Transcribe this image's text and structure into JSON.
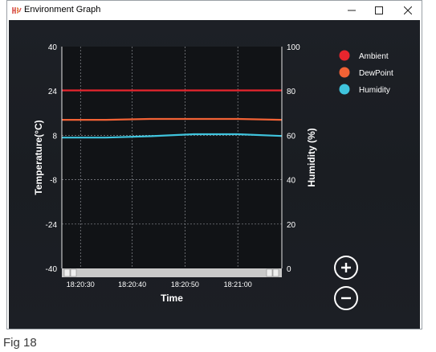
{
  "window": {
    "title": "Environment Graph",
    "controls": [
      "minimize",
      "maximize",
      "close"
    ]
  },
  "chart_data": {
    "type": "line",
    "xlabel": "Time",
    "ylabel_left": "Temperature(°C)",
    "ylabel_right": "Humidity (%)",
    "x_ticks": [
      "18:20:30",
      "18:20:40",
      "18:20:50",
      "18:21:00"
    ],
    "left_axis": {
      "ylim": [
        -40,
        40
      ],
      "ticks": [
        "40",
        "24",
        "8",
        "-8",
        "-24",
        "-40"
      ]
    },
    "right_axis": {
      "ylim": [
        0,
        100
      ],
      "ticks": [
        "100",
        "80",
        "60",
        "40",
        "20",
        "0"
      ]
    },
    "grid": true,
    "legend_position": "right",
    "x": [
      0,
      0.2,
      0.4,
      0.6,
      0.8,
      1.0
    ],
    "series": [
      {
        "name": "Ambient",
        "axis": "left",
        "color": "#e8262e",
        "values": [
          24.2,
          24.2,
          24.2,
          24.2,
          24.2,
          24.2
        ]
      },
      {
        "name": "DewPoint",
        "axis": "left",
        "color": "#f26235",
        "values": [
          13.6,
          13.6,
          13.9,
          13.9,
          13.9,
          13.6
        ]
      },
      {
        "name": "Humidity",
        "axis": "right",
        "color": "#3fc4dd",
        "values": [
          59.0,
          59.0,
          59.6,
          60.5,
          60.5,
          59.7
        ]
      }
    ]
  },
  "zoom": {
    "in_icon": "zoom-in-icon",
    "out_icon": "zoom-out-icon"
  },
  "caption": "Fig 18"
}
